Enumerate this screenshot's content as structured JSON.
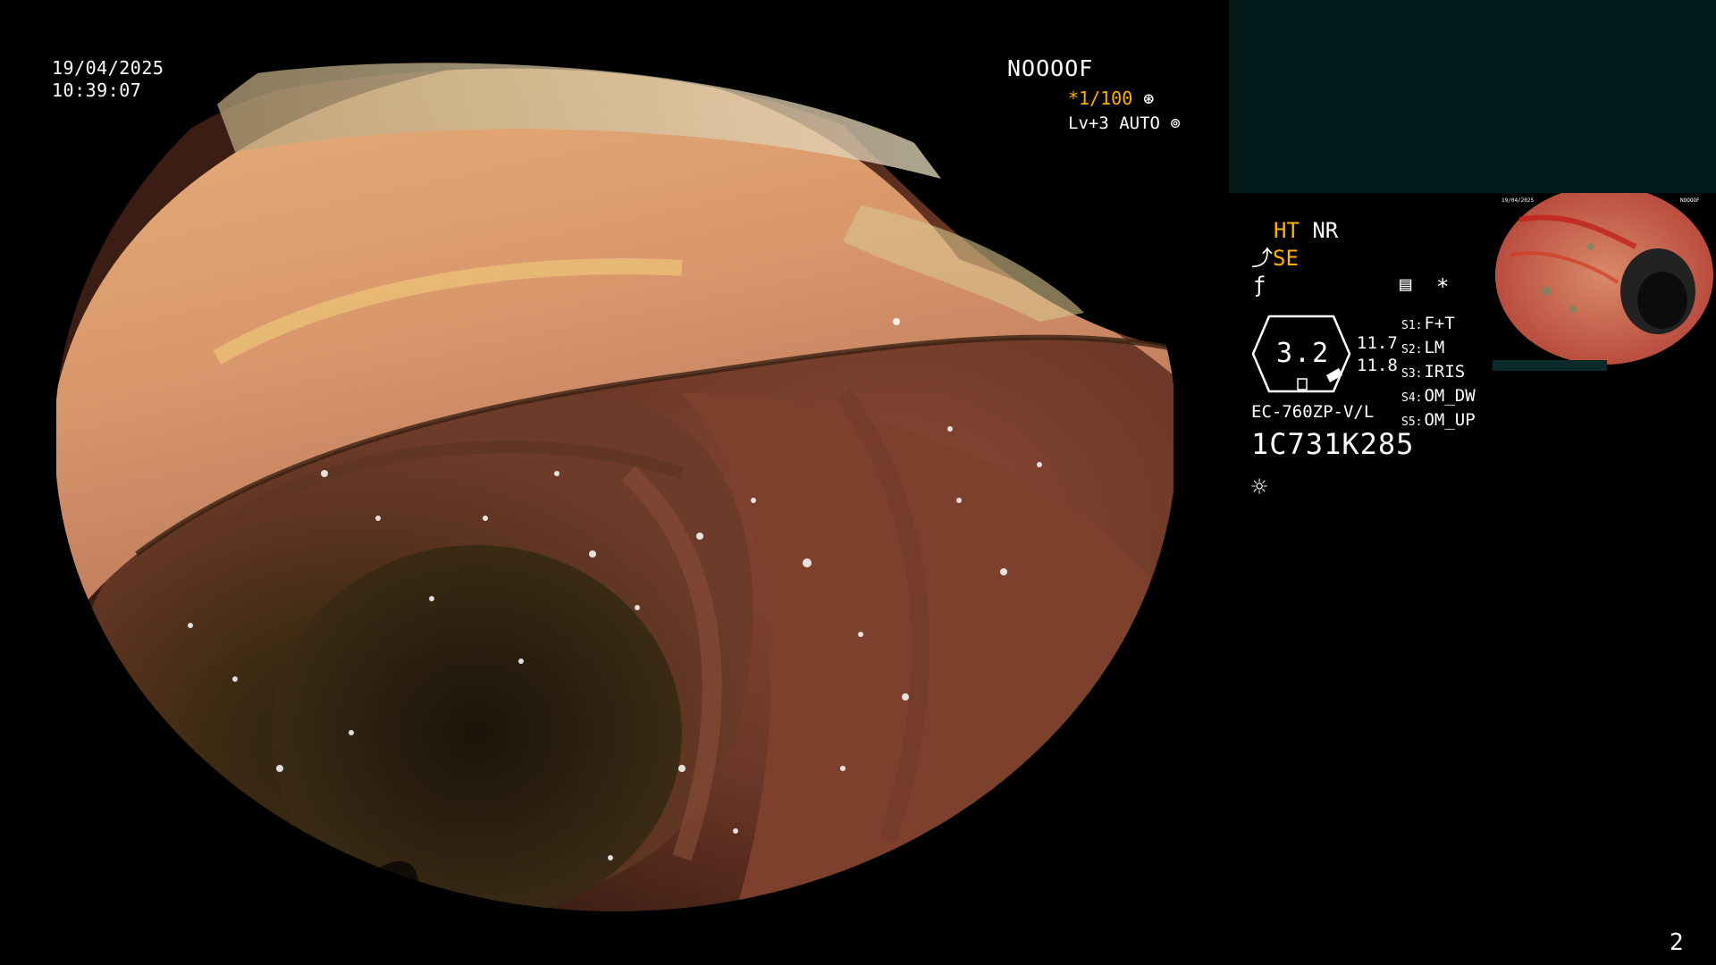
{
  "overlay": {
    "date": "19/04/2025",
    "time": "10:39:07",
    "patient_id": "NOOOOF",
    "shutter": "*1/100",
    "shutter_icon": "aperture-icon",
    "level": "Lv+3 AUTO",
    "level_icon": "iris-icon"
  },
  "panel": {
    "mode_ht": "HT",
    "mode_nr": "NR",
    "mode_se": "SE",
    "enhance_icon": "structure-enhance-icon",
    "filter_icon": "filter-icon",
    "memo_icon": "memo-icon",
    "star": "*",
    "gauge": {
      "value": "3.2",
      "upper": "11.7",
      "lower": "11.8"
    },
    "settings": [
      {
        "key": "S1:",
        "value": "F+T"
      },
      {
        "key": "S2:",
        "value": "LM"
      },
      {
        "key": "S3:",
        "value": "IRIS"
      },
      {
        "key": "S4:",
        "value": "OM_DW"
      },
      {
        "key": "S5:",
        "value": "OM_UP"
      }
    ],
    "model": "EC-760ZP-V/L",
    "serial": "1C731K285",
    "light_icon": "brightness-icon"
  },
  "page": {
    "number": "2"
  },
  "colors": {
    "overlay_text": "#ffffff",
    "highlight": "#ffb000",
    "preview_bg": "#021a1a",
    "background": "#000000"
  }
}
